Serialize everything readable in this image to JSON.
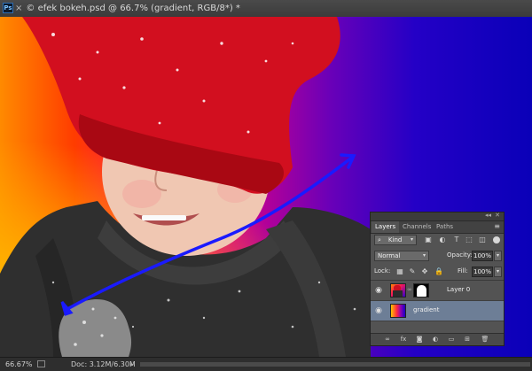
{
  "window": {
    "app_badge": "Ps",
    "tab_close": "×",
    "doc_title": "© efek bokeh.psd @ 66.7% (gradient, RGB/8*) *"
  },
  "statusbar": {
    "zoom": "66.67%",
    "doc_size": "Doc: 3.12M/6.30M",
    "arrow": "▸"
  },
  "layers_panel": {
    "collapse_glyph": "◂◂",
    "close_glyph": "✕",
    "menu_glyph": "≡",
    "tabs": [
      "Layers",
      "Channels",
      "Paths"
    ],
    "filter": {
      "search_glyph": "⌕",
      "kind": "Kind",
      "arrow": "▾"
    },
    "blend_mode": "Normal",
    "opacity_label": "Opacity:",
    "opacity_value": "100%",
    "lock_label": "Lock:",
    "fill_label": "Fill:",
    "fill_value": "100%",
    "dropdown_arrow": "▾",
    "layers": [
      {
        "name": "Layer 0",
        "visible": true,
        "selected": false,
        "has_mask": true
      },
      {
        "name": "gradient",
        "visible": true,
        "selected": true,
        "has_mask": false
      }
    ]
  },
  "colors": {
    "gradient_start": "#ffea00",
    "gradient_mid": "#ff1160",
    "gradient_end": "#0a00b8",
    "gradient_drag_line": "#1a1aff",
    "selected_layer": "#6d7e96"
  }
}
